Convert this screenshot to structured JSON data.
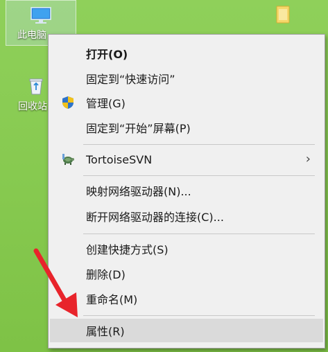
{
  "desktop": {
    "icons": [
      {
        "label": "此电脑"
      },
      {
        "label": "回收站"
      }
    ]
  },
  "menu": {
    "items": [
      {
        "label": "打开(O)",
        "bold": true
      },
      {
        "label": "固定到“快速访问”"
      },
      {
        "label": "管理(G)",
        "icon": "shield-icon"
      },
      {
        "label": "固定到“开始”屏幕(P)"
      },
      {
        "label": "TortoiseSVN",
        "icon": "tortoise-icon",
        "submenu": true
      },
      {
        "label": "映射网络驱动器(N)..."
      },
      {
        "label": "断开网络驱动器的连接(C)..."
      },
      {
        "label": "创建快捷方式(S)"
      },
      {
        "label": "删除(D)"
      },
      {
        "label": "重命名(M)"
      },
      {
        "label": "属性(R)",
        "highlighted": true
      }
    ],
    "submenu_arrow": "›"
  },
  "annotation": {
    "type": "red-arrow",
    "color": "#e8242b"
  }
}
